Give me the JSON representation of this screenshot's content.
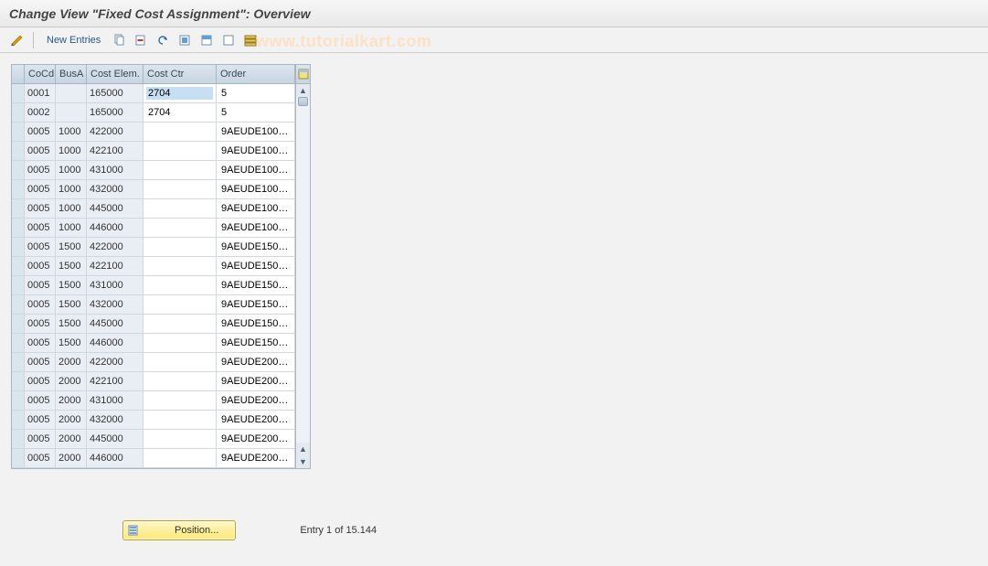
{
  "title": "Change View \"Fixed Cost Assignment\": Overview",
  "toolbar": {
    "new_entries_label": "New Entries"
  },
  "watermark": "www.tutorialkart.com",
  "table": {
    "headers": {
      "cocd": "CoCd",
      "busa": "BusA",
      "elem": "Cost Elem.",
      "ctr": "Cost Ctr",
      "order": "Order"
    },
    "selected_cell": {
      "row": 0,
      "col": "ctr"
    },
    "rows": [
      {
        "cocd": "0001",
        "busa": "",
        "elem": "165000",
        "ctr": "2704",
        "order": "5"
      },
      {
        "cocd": "0002",
        "busa": "",
        "elem": "165000",
        "ctr": "2704",
        "order": "5"
      },
      {
        "cocd": "0005",
        "busa": "1000",
        "elem": "422000",
        "ctr": "",
        "order": "9AEUDE100…"
      },
      {
        "cocd": "0005",
        "busa": "1000",
        "elem": "422100",
        "ctr": "",
        "order": "9AEUDE100…"
      },
      {
        "cocd": "0005",
        "busa": "1000",
        "elem": "431000",
        "ctr": "",
        "order": "9AEUDE100…"
      },
      {
        "cocd": "0005",
        "busa": "1000",
        "elem": "432000",
        "ctr": "",
        "order": "9AEUDE100…"
      },
      {
        "cocd": "0005",
        "busa": "1000",
        "elem": "445000",
        "ctr": "",
        "order": "9AEUDE100…"
      },
      {
        "cocd": "0005",
        "busa": "1000",
        "elem": "446000",
        "ctr": "",
        "order": "9AEUDE100…"
      },
      {
        "cocd": "0005",
        "busa": "1500",
        "elem": "422000",
        "ctr": "",
        "order": "9AEUDE150…"
      },
      {
        "cocd": "0005",
        "busa": "1500",
        "elem": "422100",
        "ctr": "",
        "order": "9AEUDE150…"
      },
      {
        "cocd": "0005",
        "busa": "1500",
        "elem": "431000",
        "ctr": "",
        "order": "9AEUDE150…"
      },
      {
        "cocd": "0005",
        "busa": "1500",
        "elem": "432000",
        "ctr": "",
        "order": "9AEUDE150…"
      },
      {
        "cocd": "0005",
        "busa": "1500",
        "elem": "445000",
        "ctr": "",
        "order": "9AEUDE150…"
      },
      {
        "cocd": "0005",
        "busa": "1500",
        "elem": "446000",
        "ctr": "",
        "order": "9AEUDE150…"
      },
      {
        "cocd": "0005",
        "busa": "2000",
        "elem": "422000",
        "ctr": "",
        "order": "9AEUDE200…"
      },
      {
        "cocd": "0005",
        "busa": "2000",
        "elem": "422100",
        "ctr": "",
        "order": "9AEUDE200…"
      },
      {
        "cocd": "0005",
        "busa": "2000",
        "elem": "431000",
        "ctr": "",
        "order": "9AEUDE200…"
      },
      {
        "cocd": "0005",
        "busa": "2000",
        "elem": "432000",
        "ctr": "",
        "order": "9AEUDE200…"
      },
      {
        "cocd": "0005",
        "busa": "2000",
        "elem": "445000",
        "ctr": "",
        "order": "9AEUDE200…"
      },
      {
        "cocd": "0005",
        "busa": "2000",
        "elem": "446000",
        "ctr": "",
        "order": "9AEUDE200…"
      }
    ]
  },
  "footer": {
    "position_label": "Position...",
    "entry_text": "Entry 1 of 15.144"
  }
}
